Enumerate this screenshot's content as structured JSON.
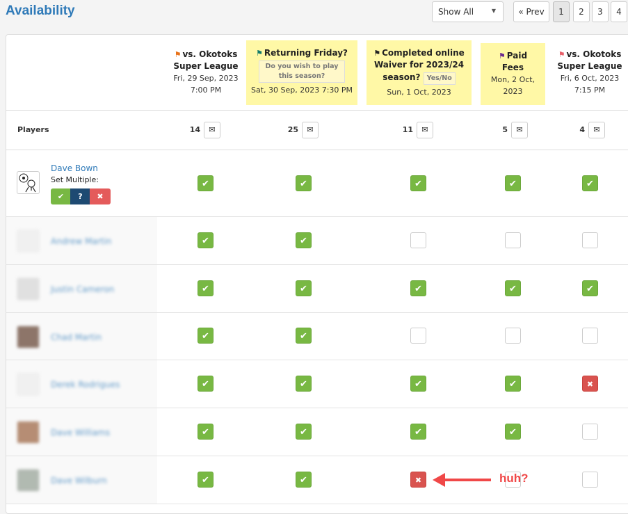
{
  "page": {
    "title": "Availability"
  },
  "filter": {
    "selected": "Show All"
  },
  "pagination": {
    "prev_label": "« Prev",
    "pages": [
      "1",
      "2",
      "3",
      "4"
    ],
    "active_page": "1"
  },
  "events": [
    {
      "title_line1": "vs. Okotoks",
      "title_line2": "Super League",
      "question": "",
      "date": "Fri, 29 Sep, 2023",
      "time": "7:00 PM",
      "flag_color": "#e8731b",
      "highlighted": false,
      "count": "14"
    },
    {
      "title_line1": "Returning Friday?",
      "title_line2": "",
      "question": "Do you wish to play this season?",
      "date": "Sat, 30 Sep, 2023 7:30 PM",
      "time": "",
      "flag_color": "#127a6a",
      "highlighted": true,
      "count": "25"
    },
    {
      "title_line1": "Completed online",
      "title_line2": "Waiver for 2023/24",
      "title_line3": "season?",
      "tag": "Yes/No",
      "date": "Sun, 1 Oct, 2023",
      "time": "",
      "flag_color": "#222222",
      "highlighted": true,
      "count": "11"
    },
    {
      "title_line1": "Paid",
      "title_line2": "Fees",
      "question": "",
      "date": "Mon, 2 Oct,",
      "time": "2023",
      "flag_color": "#6b2a8e",
      "highlighted": true,
      "count": "5"
    },
    {
      "title_line1": "vs. Okotoks",
      "title_line2": "Super League",
      "question": "",
      "date": "Fri, 6 Oct, 2023",
      "time": "7:15 PM",
      "flag_color": "#e8606a",
      "highlighted": false,
      "count": "4"
    }
  ],
  "players_header": "Players",
  "set_multiple": {
    "label": "Set Multiple:",
    "yes": "✔",
    "maybe": "?",
    "no": "✖"
  },
  "players": [
    {
      "name": "Dave Bown",
      "status": [
        "yes",
        "yes",
        "yes",
        "yes",
        "yes"
      ]
    },
    {
      "name": "Andrew Martin",
      "status": [
        "yes",
        "yes",
        "empty",
        "empty",
        "empty"
      ]
    },
    {
      "name": "Justin Cameron",
      "status": [
        "yes",
        "yes",
        "yes",
        "yes",
        "yes"
      ]
    },
    {
      "name": "Chad Martin",
      "status": [
        "yes",
        "yes",
        "empty",
        "empty",
        "empty"
      ]
    },
    {
      "name": "Derek Rodrigues",
      "status": [
        "yes",
        "yes",
        "yes",
        "yes",
        "no"
      ]
    },
    {
      "name": "Dave Williams",
      "status": [
        "yes",
        "yes",
        "yes",
        "yes",
        "empty"
      ]
    },
    {
      "name": "Dave Wilburn",
      "status": [
        "yes",
        "yes",
        "no",
        "empty",
        "empty"
      ]
    }
  ],
  "annotation": {
    "text": "huh?",
    "color": "#f04848"
  },
  "colors": {
    "accent": "#2f7ab8",
    "yes": "#78b843",
    "no": "#d9534f",
    "highlight": "#fff8a6"
  }
}
